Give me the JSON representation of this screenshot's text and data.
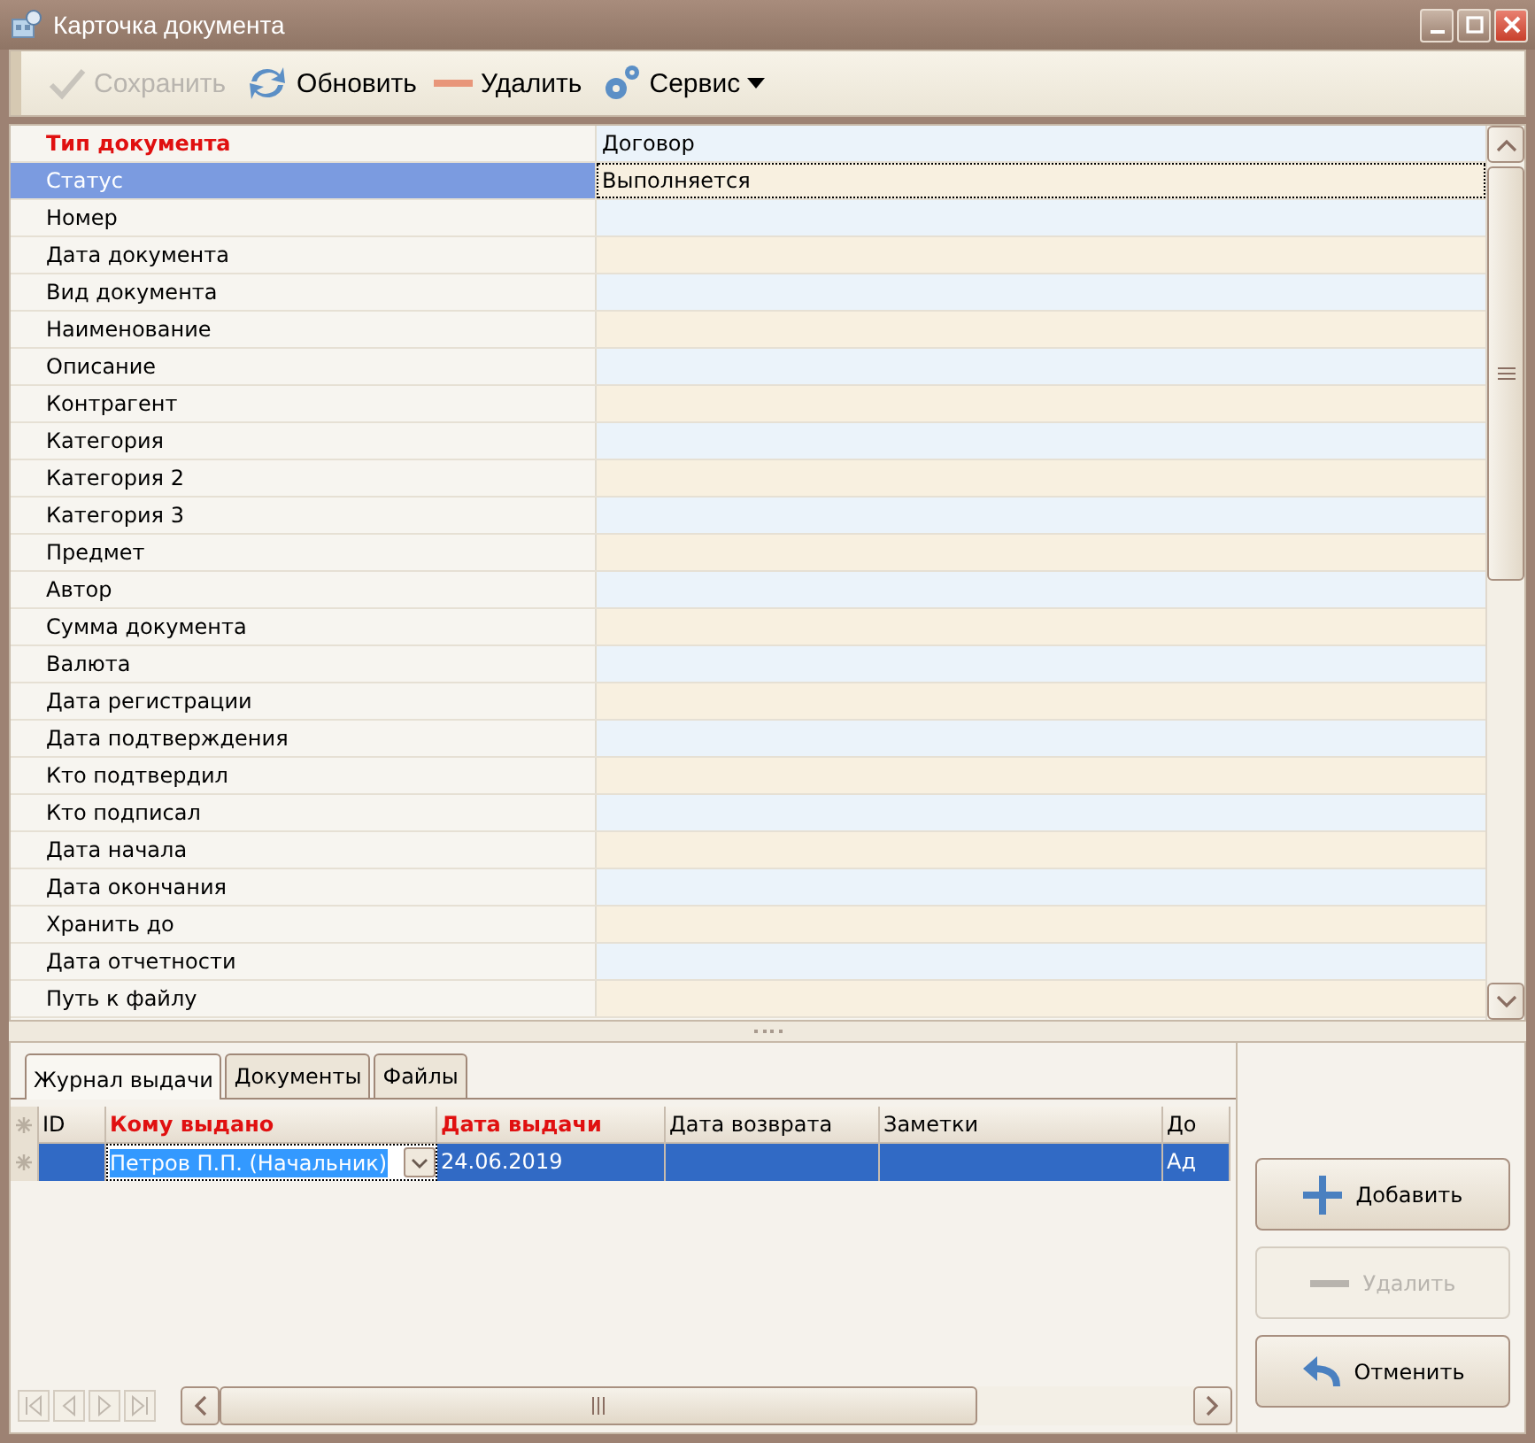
{
  "window": {
    "title": "Карточка документа"
  },
  "toolbar": [
    {
      "label": "Сохранить",
      "kind": "check",
      "disabled": true
    },
    {
      "label": "Обновить",
      "kind": "refresh",
      "disabled": false
    },
    {
      "label": "Удалить",
      "kind": "minus",
      "disabled": false
    },
    {
      "label": "Сервис",
      "kind": "gears",
      "disabled": false,
      "dropdown": true
    }
  ],
  "properties": [
    {
      "label": "Тип документа",
      "value": "Договор",
      "required": true,
      "selected": false
    },
    {
      "label": "Статус",
      "value": "Выполняется",
      "required": false,
      "selected": true
    },
    {
      "label": "Номер",
      "required": false,
      "selected": false
    },
    {
      "label": "Дата документа",
      "required": false,
      "selected": false
    },
    {
      "label": "Вид документа",
      "required": false,
      "selected": false
    },
    {
      "label": "Наименование",
      "required": false,
      "selected": false
    },
    {
      "label": "Описание",
      "required": false,
      "selected": false
    },
    {
      "label": "Контрагент",
      "required": false,
      "selected": false
    },
    {
      "label": "Категория",
      "required": false,
      "selected": false
    },
    {
      "label": "Категория 2",
      "required": false,
      "selected": false
    },
    {
      "label": "Категория 3",
      "required": false,
      "selected": false
    },
    {
      "label": "Предмет",
      "required": false,
      "selected": false
    },
    {
      "label": "Автор",
      "required": false,
      "selected": false
    },
    {
      "label": "Сумма документа",
      "required": false,
      "selected": false
    },
    {
      "label": "Валюта",
      "required": false,
      "selected": false
    },
    {
      "label": "Дата регистрации",
      "required": false,
      "selected": false
    },
    {
      "label": "Дата подтверждения",
      "required": false,
      "selected": false
    },
    {
      "label": "Кто подтвердил",
      "required": false,
      "selected": false
    },
    {
      "label": "Кто подписал",
      "required": false,
      "selected": false
    },
    {
      "label": "Дата начала",
      "required": false,
      "selected": false
    },
    {
      "label": "Дата окончания",
      "required": false,
      "selected": false
    },
    {
      "label": "Хранить до",
      "required": false,
      "selected": false
    },
    {
      "label": "Дата отчетности",
      "required": false,
      "selected": false
    },
    {
      "label": "Путь к файлу",
      "required": false,
      "selected": false
    }
  ],
  "tabs": [
    {
      "label": "Журнал выдачи",
      "selected": true
    },
    {
      "label": "Документы",
      "selected": false
    },
    {
      "label": "Файлы",
      "selected": false
    }
  ],
  "table": {
    "columns": [
      {
        "label": "ID",
        "required": false
      },
      {
        "label": "Кому выдано",
        "required": true
      },
      {
        "label": "Дата выдачи",
        "required": true
      },
      {
        "label": "Дата возврата",
        "required": false
      },
      {
        "label": "Заметки",
        "required": false
      },
      {
        "label": "До",
        "required": false
      }
    ],
    "rows": [
      {
        "selected": true,
        "cells": [
          "",
          "Петров П.П. (Начальник)",
          "24.06.2019",
          "",
          "",
          "Ад"
        ]
      }
    ]
  },
  "buttons": [
    {
      "label": "Добавить",
      "kind": "plus",
      "disabled": false
    },
    {
      "label": "Удалить",
      "kind": "minus",
      "disabled": true
    },
    {
      "label": "Отменить",
      "kind": "undo",
      "disabled": false
    }
  ]
}
